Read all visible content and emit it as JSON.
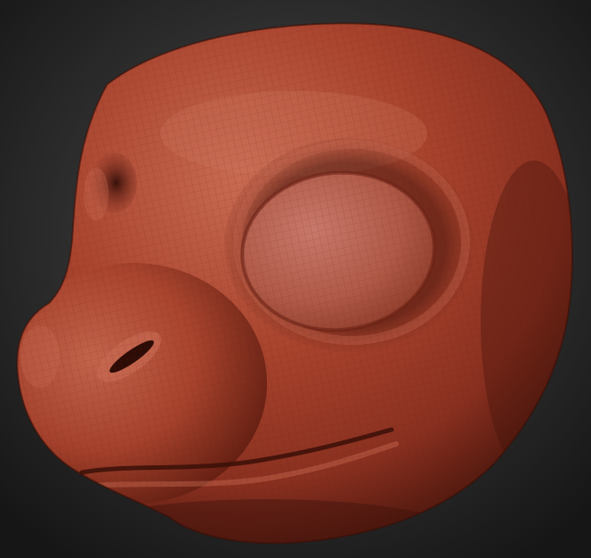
{
  "scene": {
    "subject": "sculpted-creature-head",
    "material": "red-wax-matcap",
    "render_mode": "polyframe-wireframe-overlay",
    "background_style": "radial-gradient"
  },
  "colors": {
    "background_center": "#4a4a4a",
    "background_edge": "#161616",
    "material_highlight": "#d27a62",
    "material_base": "#a8432d",
    "material_mid": "#8a3020",
    "material_shadow": "#3e120a",
    "wire_line": "#5a1c10"
  }
}
